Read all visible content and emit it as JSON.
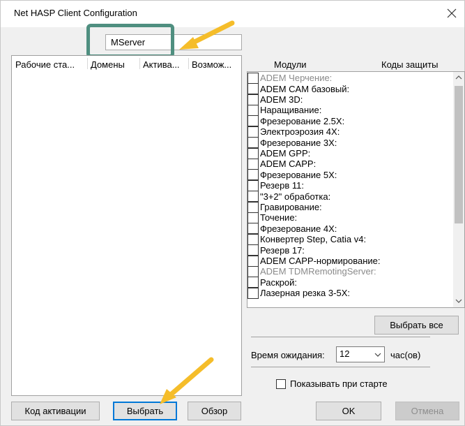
{
  "window": {
    "title": "Net HASP Client Configuration",
    "close_icon": "close-icon"
  },
  "server": {
    "value": "MServer"
  },
  "workstations": {
    "columns": [
      "Рабочие ста...",
      "Домены",
      "Актива...",
      "Возмож..."
    ],
    "rows": []
  },
  "modules": {
    "header_left": "Модули",
    "header_right": "Коды защиты",
    "items": [
      {
        "label": "ADEM Черчение:",
        "disabled": true,
        "checked": false
      },
      {
        "label": "ADEM CAM базовый:",
        "disabled": false,
        "checked": false
      },
      {
        "label": "ADEM 3D:",
        "disabled": false,
        "checked": false
      },
      {
        "label": "Наращивание:",
        "disabled": false,
        "checked": false
      },
      {
        "label": "Фрезерование 2.5X:",
        "disabled": false,
        "checked": false
      },
      {
        "label": "Электроэрозия 4X:",
        "disabled": false,
        "checked": false
      },
      {
        "label": "Фрезерование 3X:",
        "disabled": false,
        "checked": false
      },
      {
        "label": "ADEM GPP:",
        "disabled": false,
        "checked": false
      },
      {
        "label": "ADEM CAPP:",
        "disabled": false,
        "checked": false
      },
      {
        "label": "Фрезерование 5X:",
        "disabled": false,
        "checked": false
      },
      {
        "label": "Резерв 11:",
        "disabled": false,
        "checked": false
      },
      {
        "label": "\"3+2\" обработка:",
        "disabled": false,
        "checked": false
      },
      {
        "label": "Гравирование:",
        "disabled": false,
        "checked": false
      },
      {
        "label": "Точение:",
        "disabled": false,
        "checked": false
      },
      {
        "label": "Фрезерование 4X:",
        "disabled": false,
        "checked": false
      },
      {
        "label": "Конвертер Step, Catia v4:",
        "disabled": false,
        "checked": false
      },
      {
        "label": "Резерв 17:",
        "disabled": false,
        "checked": false
      },
      {
        "label": "ADEM CAPP-нормирование:",
        "disabled": false,
        "checked": false
      },
      {
        "label": "ADEM TDMRemotingServer:",
        "disabled": true,
        "checked": false
      },
      {
        "label": "Раскрой:",
        "disabled": false,
        "checked": false
      },
      {
        "label": "Лазерная резка 3-5X:",
        "disabled": false,
        "checked": false
      }
    ],
    "select_all_label": "Выбрать все"
  },
  "timeout": {
    "label": "Время ожидания:",
    "value": "12",
    "unit": "час(ов)"
  },
  "show_on_start": {
    "label": "Показывать при старте",
    "checked": false
  },
  "buttons": {
    "activation_code": "Код активации",
    "select": "Выбрать",
    "browse": "Обзор",
    "ok": "OK",
    "cancel": "Отмена"
  },
  "annotations": {
    "highlight_color": "#4f8f80",
    "arrow_color": "#f5bd2a"
  }
}
